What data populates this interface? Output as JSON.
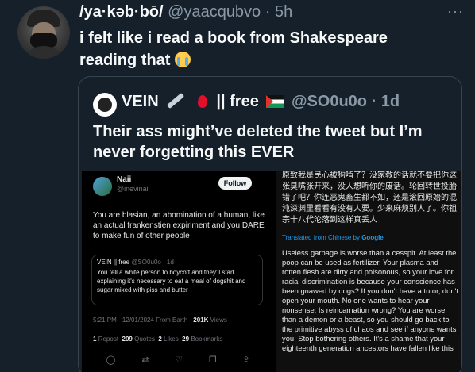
{
  "tweet": {
    "display_name": "/ya·kəb·bō/",
    "handle": "@yaacqubvo",
    "time": "· 5h",
    "text": "i felt like i read a book from Shakespeare reading that",
    "more_label": "···"
  },
  "quote": {
    "display_name": "VEIN",
    "name_suffix": "|| free",
    "handle": "@SO0u0o",
    "time": "· 1d",
    "text": "Their ass might’ve deleted the tweet but I’m never forgetting this EVER"
  },
  "screenshot": {
    "left": {
      "name": "Naii",
      "handle": "@inevinaii",
      "follow_label": "Follow",
      "text": "You are blasian, an abomination of a human, like an actual frankenstien expiriment and you DARE to make fun of other people",
      "inner_quote": {
        "name": "VEIN",
        "suffix": "|| free",
        "handle": "@SO0u0o · 1d",
        "text": "You tell a white person to boycott and they'll start explaining it's necessary to eat a meal of dogshit and sugar mixed with piss and butter"
      },
      "meta_time": "5:21 PM · 12/01/2024 From Earth ·",
      "meta_views_num": "201K",
      "meta_views_label": "Views",
      "stats": {
        "reposts_num": "1",
        "reposts_label": "Repost",
        "quotes_num": "209",
        "quotes_label": "Quotes",
        "likes_num": "2",
        "likes_label": "Likes",
        "bookmarks_num": "29",
        "bookmarks_label": "Bookmarks"
      },
      "actions": [
        "reply",
        "repost",
        "like",
        "bookmark",
        "share"
      ]
    },
    "right": {
      "chinese_text": "原致我是民心被狗啃了？没家教的话就不要把你这张臭嘴张开来，没人想听你的废话。轮回转世投胎错了吧？你连恶鬼畜生都不如，还是滚回原始的混沌深渊里看看有没有人要。少来麻烦别人了。你祖宗十八代沦落到这样真丢人",
      "translated_label": "Translated from Chinese by",
      "translated_brand": "Google",
      "english_text": "Useless garbage is worse than a cesspit. At least the poop can be used as fertilizer. Your plasma and rotten flesh are dirty and poisonous, so your love for racial discrimination is because your conscience has been gnawed by dogs? If you don't have a tutor, don't open your mouth. No one wants to hear your nonsense. Is reincarnation wrong? You are worse than a demon or a beast, so you should go back to the primitive abyss of chaos and see if anyone wants you. Stop bothering others. It's a shame that your eighteenth generation ancestors have fallen like this"
    }
  },
  "colors": {
    "background": "#15202b",
    "text_primary": "#f7f9f9",
    "text_secondary": "#8b98a5",
    "border": "#38444d",
    "link": "#1d9bf0"
  }
}
